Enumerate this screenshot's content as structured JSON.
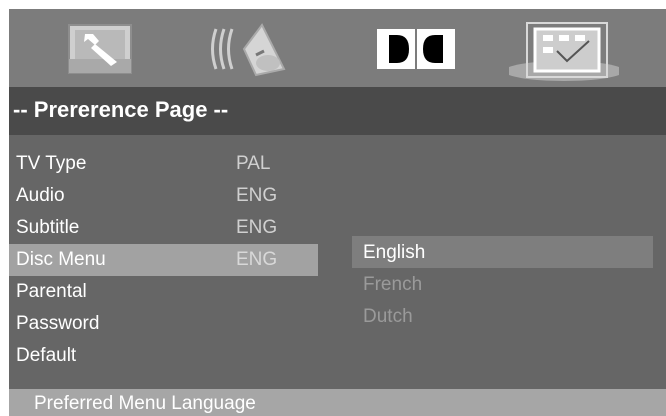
{
  "header": {
    "tabs": [
      {
        "name": "general-setup",
        "icon": "wrench-icon"
      },
      {
        "name": "audio-setup",
        "icon": "speaker-icon"
      },
      {
        "name": "dolby-setup",
        "icon": "dolby-icon"
      },
      {
        "name": "preference-setup",
        "icon": "checklist-icon",
        "active": true
      }
    ]
  },
  "page": {
    "title": "-- Prererence Page --"
  },
  "menu": {
    "items": [
      {
        "label": "TV Type",
        "value": "PAL"
      },
      {
        "label": "Audio",
        "value": "ENG"
      },
      {
        "label": "Subtitle",
        "value": "ENG"
      },
      {
        "label": "Disc Menu",
        "value": "ENG",
        "selected": true
      },
      {
        "label": "Parental",
        "value": ""
      },
      {
        "label": "Password",
        "value": ""
      },
      {
        "label": "Default",
        "value": ""
      }
    ]
  },
  "submenu": {
    "options": [
      {
        "label": "English",
        "selected": true
      },
      {
        "label": "French"
      },
      {
        "label": "Dutch"
      }
    ]
  },
  "status": {
    "text": "Preferred Menu Language"
  },
  "colors": {
    "screen_bg": "#666666",
    "iconbar_bg": "#7c7c7c",
    "titlebar_bg": "#4a4a4a",
    "menu_highlight": "#a2a2a2",
    "option_highlight": "#7e7e7e",
    "status_bg": "#a6a6a6",
    "text": "#ffffff",
    "dim_text": "#9a9a9a"
  }
}
